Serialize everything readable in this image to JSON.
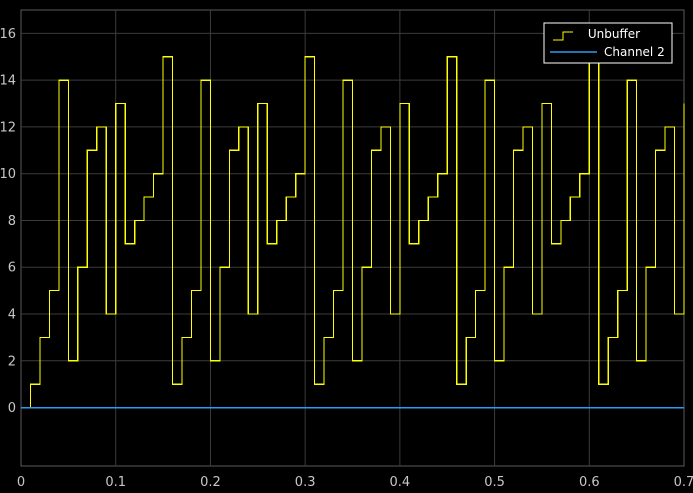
{
  "chart_data": {
    "type": "line",
    "title": "",
    "xlabel": "",
    "ylabel": "",
    "xlim": [
      0,
      0.7
    ],
    "ylim": [
      -2.5,
      17
    ],
    "grid": true,
    "legend_position": "top-right",
    "xticks": [
      0,
      0.1,
      0.2,
      0.3,
      0.4,
      0.5,
      0.6,
      0.7
    ],
    "xtick_labels": [
      "0",
      "0.1",
      "0.2",
      "0.3",
      "0.4",
      "0.5",
      "0.6",
      "0.7"
    ],
    "yticks": [
      0,
      2,
      4,
      6,
      8,
      10,
      12,
      14,
      16
    ],
    "ytick_labels": [
      "0",
      "2",
      "4",
      "6",
      "8",
      "10",
      "12",
      "14",
      "16"
    ],
    "series": [
      {
        "name": "Unbuffer",
        "color": "#ffff00",
        "style": "stairs",
        "x": [
          0.01,
          0.02,
          0.03,
          0.04,
          0.05,
          0.06,
          0.07,
          0.08,
          0.09,
          0.1,
          0.11,
          0.12,
          0.13,
          0.14,
          0.15,
          0.16,
          0.17,
          0.18,
          0.19,
          0.2,
          0.21,
          0.22,
          0.23,
          0.24,
          0.25,
          0.26,
          0.27,
          0.28,
          0.29,
          0.3,
          0.31,
          0.32,
          0.33,
          0.34,
          0.35,
          0.36,
          0.37,
          0.38,
          0.39,
          0.4,
          0.41,
          0.42,
          0.43,
          0.44,
          0.45,
          0.46,
          0.47,
          0.48,
          0.49,
          0.5,
          0.51,
          0.52,
          0.53,
          0.54,
          0.55,
          0.56,
          0.57,
          0.58,
          0.59,
          0.6,
          0.61,
          0.62,
          0.63,
          0.64,
          0.65,
          0.66,
          0.67,
          0.68,
          0.69,
          0.7
        ],
        "y": [
          1,
          3,
          5,
          14,
          2,
          6,
          11,
          12,
          4,
          13,
          7,
          8,
          9,
          10,
          15,
          1,
          3,
          5,
          14,
          2,
          6,
          11,
          12,
          4,
          13,
          7,
          8,
          9,
          10,
          15,
          1,
          3,
          5,
          14,
          2,
          6,
          11,
          12,
          4,
          13,
          7,
          8,
          9,
          10,
          15,
          1,
          3,
          5,
          14,
          2,
          6,
          11,
          12,
          4,
          13,
          7,
          8,
          9,
          10,
          15,
          1,
          3,
          5,
          14,
          2,
          6,
          11,
          12,
          4,
          13
        ],
        "start": {
          "x": 0.01,
          "y": 0
        }
      },
      {
        "name": "Channel 2",
        "color": "#2e9bf0",
        "style": "line",
        "x": [
          0,
          0.7
        ],
        "y": [
          0,
          0
        ]
      }
    ]
  }
}
